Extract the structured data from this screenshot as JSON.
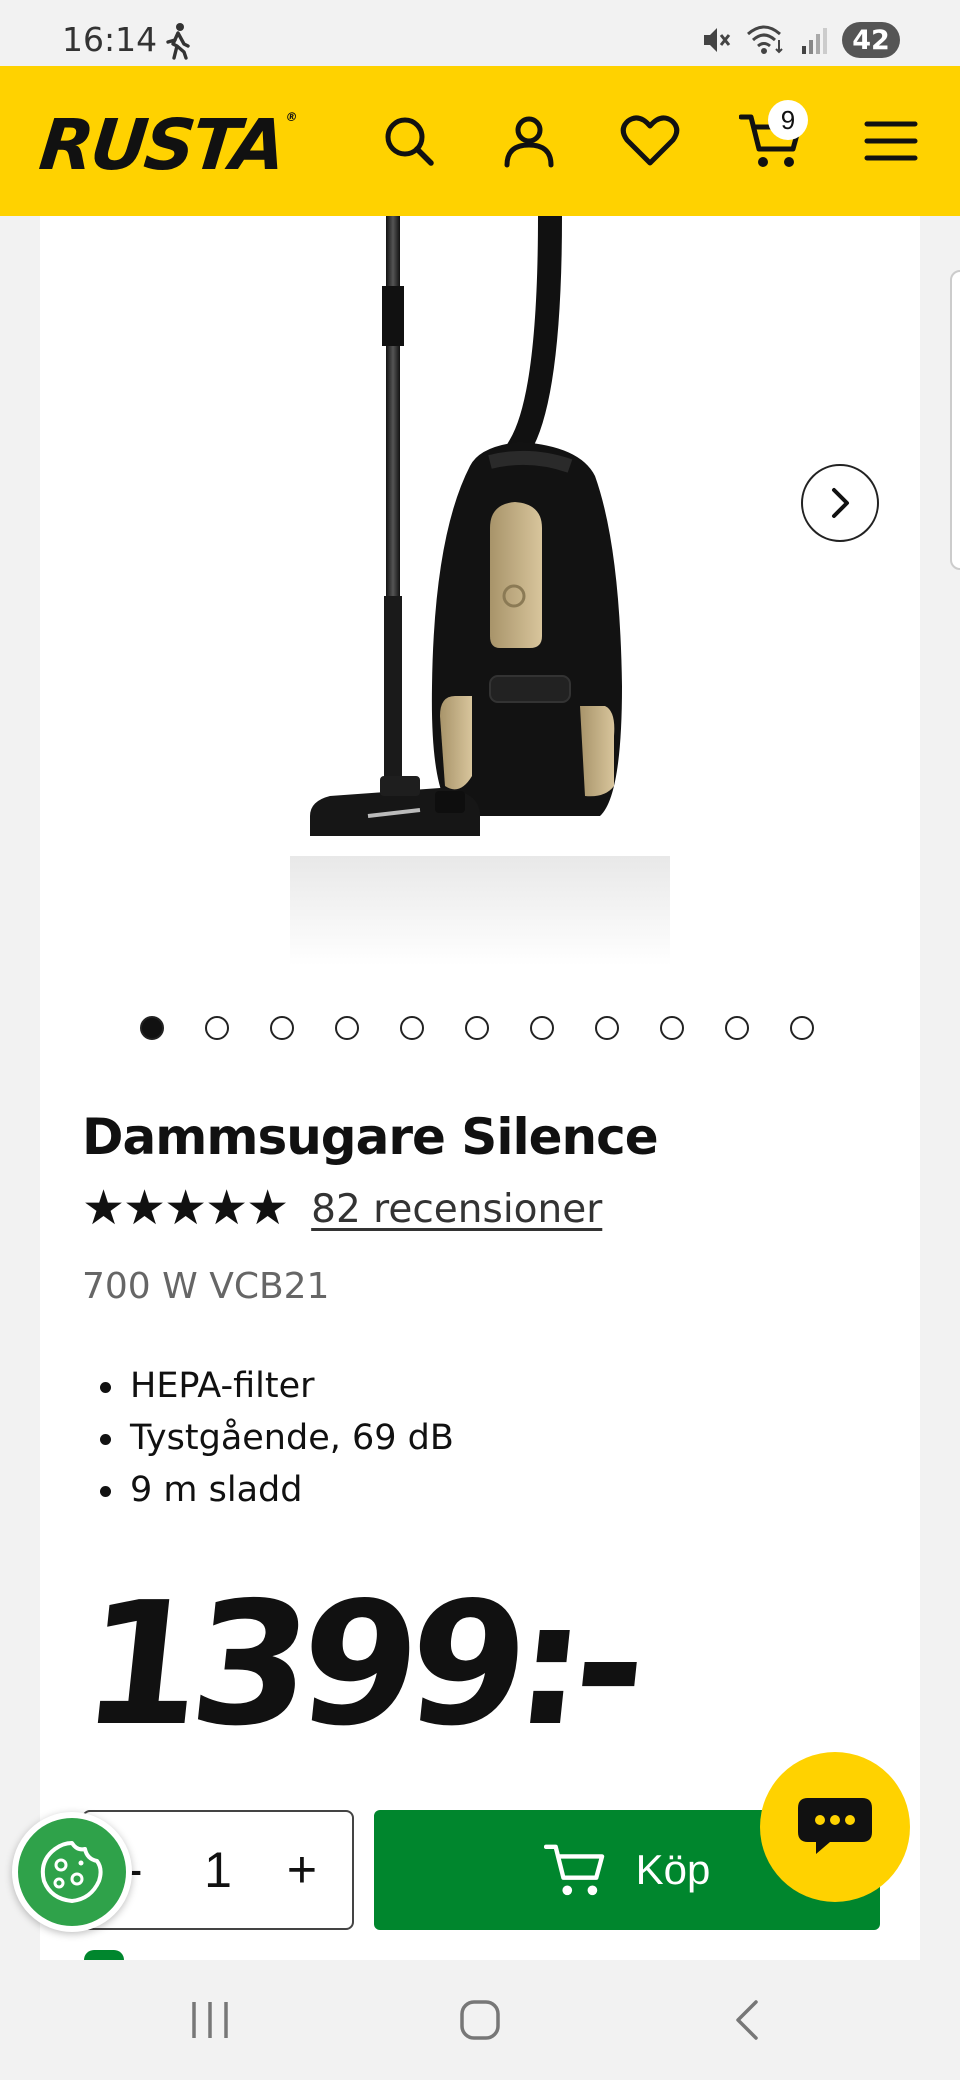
{
  "status_bar": {
    "time": "16:14",
    "battery": "42"
  },
  "header": {
    "logo": "RUSTA",
    "cart_count": "9",
    "brand_color": "#ffd200"
  },
  "product": {
    "title": "Dammsugare Silence",
    "rating_stars": "★★★★★",
    "rating_value": 4.6,
    "reviews_label": "82 recensioner",
    "subtitle": "700 W VCB21",
    "features": [
      "HEPA-filter",
      "Tystgående, 69 dB",
      "9 m sladd"
    ],
    "price": "1399:-",
    "image_count": 11,
    "active_image": 1
  },
  "purchase": {
    "quantity_minus": "-",
    "quantity": "1",
    "quantity_plus": "+",
    "buy_label": "Köp",
    "buy_color": "#00862d"
  },
  "icons": {
    "header": [
      "search-icon",
      "user-icon",
      "heart-icon",
      "cart-icon",
      "menu-icon"
    ],
    "nav": [
      "recents-icon",
      "home-icon",
      "back-icon"
    ]
  }
}
